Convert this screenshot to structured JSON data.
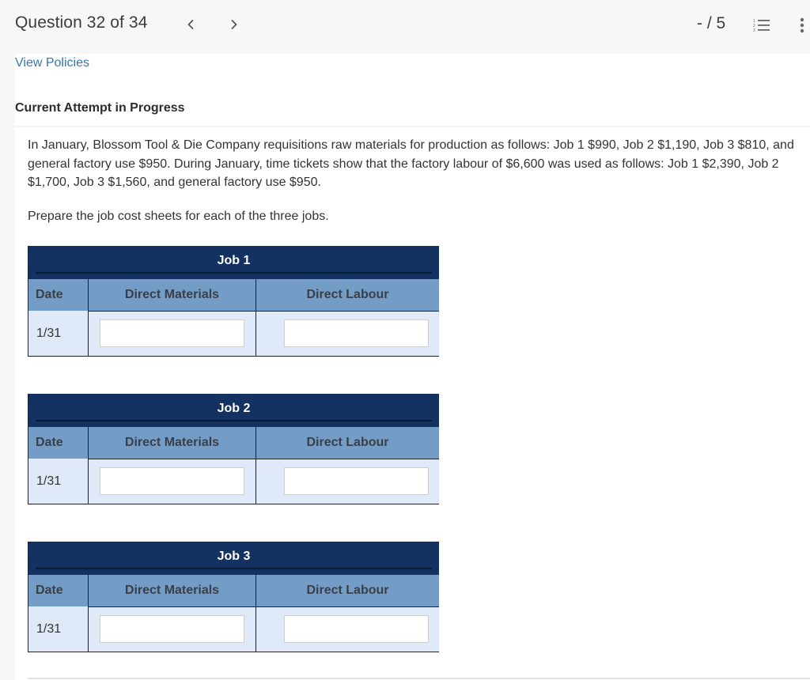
{
  "header": {
    "question_label": "Question 32 of 34",
    "prev_icon": "chevron-left-icon",
    "next_icon": "chevron-right-icon",
    "score": "- / 5",
    "question_list_icon": "numbered-list-icon",
    "more_icon": "more-vertical-icon"
  },
  "links": {
    "view_policies": "View Policies"
  },
  "status": {
    "attempt": "Current Attempt in Progress"
  },
  "question": {
    "text": "In January, Blossom Tool & Die Company requisitions raw materials for production as follows: Job 1 $990, Job 2 $1,190, Job 3 $810, and general factory use $950. During January, time tickets show that the factory labour of $6,600 was used as follows: Job 1 $2,390, Job 2 $1,700, Job 3 $1,560, and general factory use $950.",
    "instruction": "Prepare the job cost sheets for each of the three jobs."
  },
  "jobs": [
    {
      "title": "Job 1",
      "headers": {
        "date": "Date",
        "direct_materials": "Direct Materials",
        "direct_labour": "Direct Labour"
      },
      "rows": [
        {
          "date": "1/31",
          "direct_materials": "",
          "direct_labour": ""
        }
      ]
    },
    {
      "title": "Job 2",
      "headers": {
        "date": "Date",
        "direct_materials": "Direct Materials",
        "direct_labour": "Direct Labour"
      },
      "rows": [
        {
          "date": "1/31",
          "direct_materials": "",
          "direct_labour": ""
        }
      ]
    },
    {
      "title": "Job 3",
      "headers": {
        "date": "Date",
        "direct_materials": "Direct Materials",
        "direct_labour": "Direct Labour"
      },
      "rows": [
        {
          "date": "1/31",
          "direct_materials": "",
          "direct_labour": ""
        }
      ]
    }
  ],
  "colors": {
    "title_bar": "#133261",
    "header_row": "#739dc7",
    "body_row": "#e0e9f7",
    "link": "#3476ad"
  }
}
